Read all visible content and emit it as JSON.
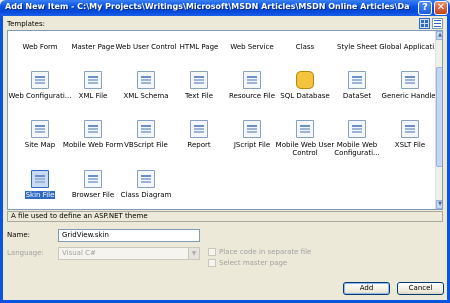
{
  "window": {
    "title": "Add New Item - C:\\My Projects\\Writings\\Microsoft\\MSDN Articles\\MSDN Online Articles\\DataTutori...",
    "help_glyph": "?",
    "close_glyph": "✕"
  },
  "templates_label": "Templates:",
  "templates": [
    {
      "label": "Web Form"
    },
    {
      "label": "Master Page"
    },
    {
      "label": "Web User Control"
    },
    {
      "label": "HTML Page"
    },
    {
      "label": "Web Service"
    },
    {
      "label": "Class"
    },
    {
      "label": "Style Sheet"
    },
    {
      "label": "Global Applicati..."
    },
    {
      "label": "Web Configurati..."
    },
    {
      "label": "XML File"
    },
    {
      "label": "XML Schema"
    },
    {
      "label": "Text File"
    },
    {
      "label": "Resource File"
    },
    {
      "label": "SQL Database"
    },
    {
      "label": "DataSet"
    },
    {
      "label": "Generic Handler"
    },
    {
      "label": "Site Map"
    },
    {
      "label": "Mobile Web Form"
    },
    {
      "label": "VBScript File"
    },
    {
      "label": "Report"
    },
    {
      "label": "JScript File"
    },
    {
      "label": "Mobile Web User Control"
    },
    {
      "label": "Mobile Web Configurati..."
    },
    {
      "label": "XSLT File"
    },
    {
      "label": "Skin File",
      "selected": true
    },
    {
      "label": "Browser File"
    },
    {
      "label": "Class Diagram"
    }
  ],
  "description": "A file used to define an ASP.NET theme",
  "name_label": "Name:",
  "name_value": "GridView.skin",
  "language_label": "Language:",
  "language_value": "Visual C#",
  "place_code_label": "Place code in separate file",
  "master_page_label": "Select master page",
  "add_label": "Add",
  "cancel_label": "Cancel",
  "colors": {
    "title_bar": "#0a54e3",
    "selection": "#316ac5",
    "dialog_bg": "#ece9d8"
  }
}
